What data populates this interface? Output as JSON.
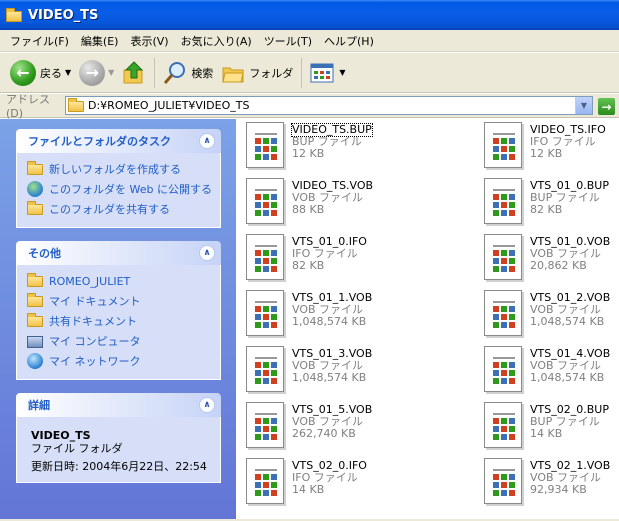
{
  "window": {
    "title": "VIDEO_TS"
  },
  "menu": [
    "ファイル(F)",
    "編集(E)",
    "表示(V)",
    "お気に入り(A)",
    "ツール(T)",
    "ヘルプ(H)"
  ],
  "toolbar": {
    "back": "戻る",
    "search": "検索",
    "folders": "フォルダ"
  },
  "address": {
    "label": "アドレス(D)",
    "value": "D:¥ROMEO_JULIET¥VIDEO_TS"
  },
  "tasks": {
    "title": "ファイルとフォルダのタスク",
    "items": [
      "新しいフォルダを作成する",
      "このフォルダを Web に公開する",
      "このフォルダを共有する"
    ]
  },
  "other": {
    "title": "その他",
    "items": [
      "ROMEO_JULIET",
      "マイ ドキュメント",
      "共有ドキュメント",
      "マイ コンピュータ",
      "マイ ネットワーク"
    ]
  },
  "details": {
    "title": "詳細",
    "name": "VIDEO_TS",
    "type": "ファイル フォルダ",
    "modified": "更新日時: 2004年6月22日、22:54"
  },
  "files": [
    {
      "name": "VIDEO_TS.BUP",
      "type": "BUP ファイル",
      "size": "12 KB"
    },
    {
      "name": "VIDEO_TS.IFO",
      "type": "IFO ファイル",
      "size": "12 KB"
    },
    {
      "name": "VIDEO_TS.VOB",
      "type": "VOB ファイル",
      "size": "88 KB"
    },
    {
      "name": "VTS_01_0.BUP",
      "type": "BUP ファイル",
      "size": "82 KB"
    },
    {
      "name": "VTS_01_0.IFO",
      "type": "IFO ファイル",
      "size": "82 KB"
    },
    {
      "name": "VTS_01_0.VOB",
      "type": "VOB ファイル",
      "size": "20,862 KB"
    },
    {
      "name": "VTS_01_1.VOB",
      "type": "VOB ファイル",
      "size": "1,048,574 KB"
    },
    {
      "name": "VTS_01_2.VOB",
      "type": "VOB ファイル",
      "size": "1,048,574 KB"
    },
    {
      "name": "VTS_01_3.VOB",
      "type": "VOB ファイル",
      "size": "1,048,574 KB"
    },
    {
      "name": "VTS_01_4.VOB",
      "type": "VOB ファイル",
      "size": "1,048,574 KB"
    },
    {
      "name": "VTS_01_5.VOB",
      "type": "VOB ファイル",
      "size": "262,740 KB"
    },
    {
      "name": "VTS_02_0.BUP",
      "type": "BUP ファイル",
      "size": "14 KB"
    },
    {
      "name": "VTS_02_0.IFO",
      "type": "IFO ファイル",
      "size": "14 KB"
    },
    {
      "name": "VTS_02_1.VOB",
      "type": "VOB ファイル",
      "size": "92,934 KB"
    }
  ]
}
